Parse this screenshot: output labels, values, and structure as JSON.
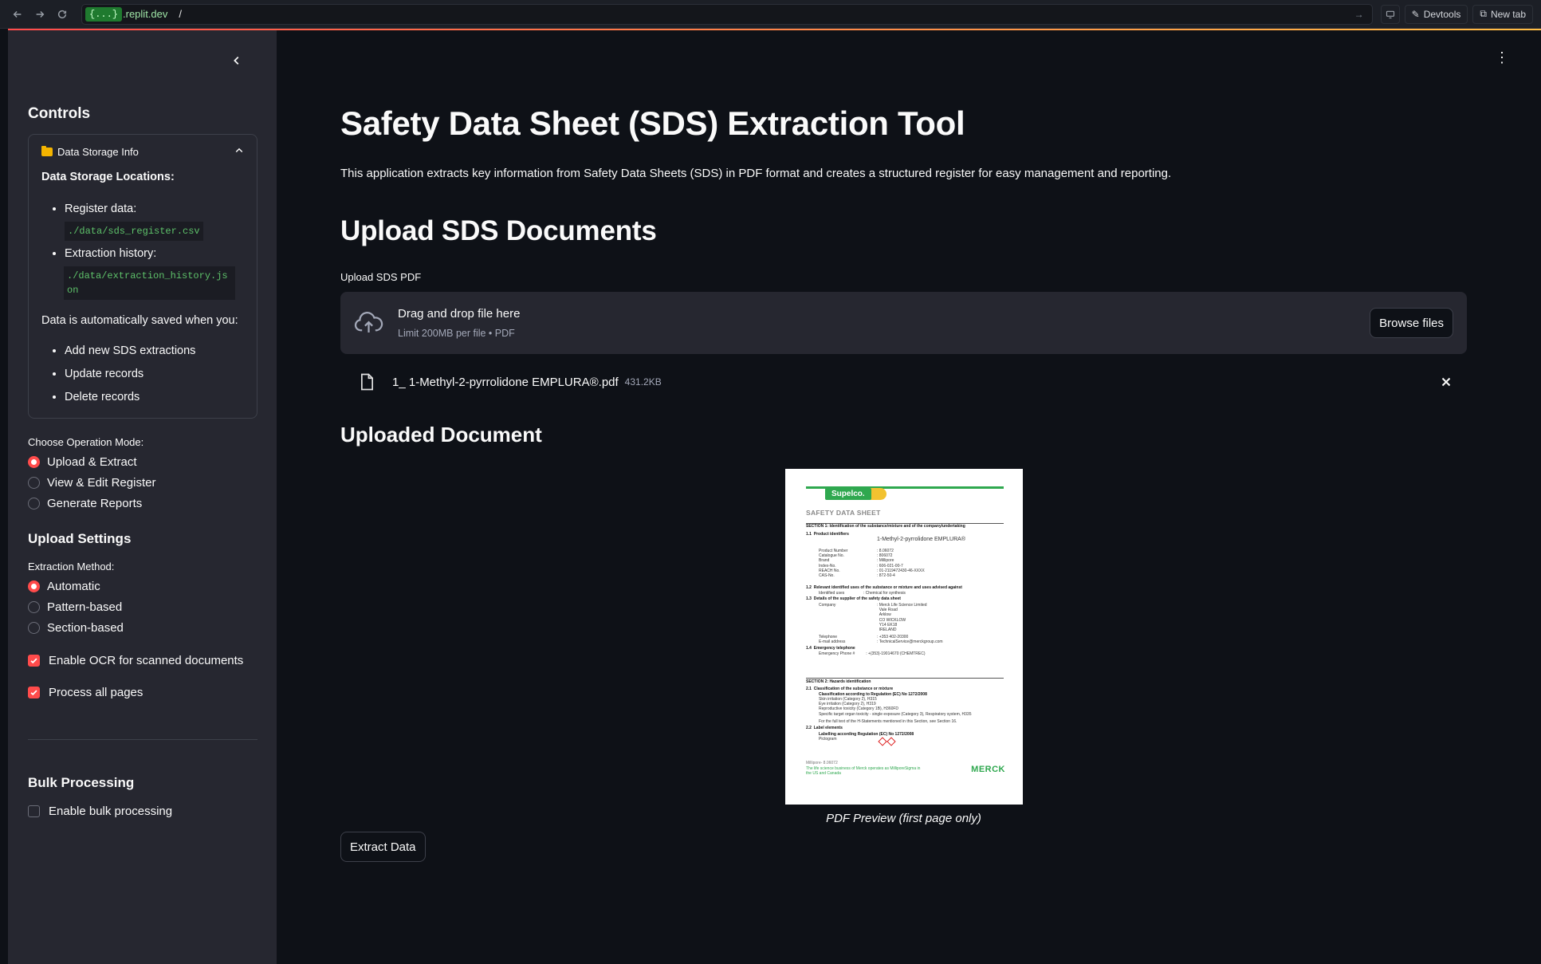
{
  "browser": {
    "url_badge": "{...}",
    "url_host": ".replit.dev",
    "url_path": "/",
    "devtools_label": "Devtools",
    "newtab_label": "New tab"
  },
  "sidebar": {
    "controls_title": "Controls",
    "expander": {
      "title": "Data Storage Info",
      "locations_heading": "Data Storage Locations:",
      "register_label": "Register data:",
      "register_path": "./data/sds_register.csv",
      "history_label": "Extraction history:",
      "history_path": "./data/extraction_history.json",
      "autosave_text": "Data is automatically saved when you:",
      "autosave_items": [
        "Add new SDS extractions",
        "Update records",
        "Delete records"
      ]
    },
    "mode": {
      "label": "Choose Operation Mode:",
      "options": [
        "Upload & Extract",
        "View & Edit Register",
        "Generate Reports"
      ],
      "selected": "Upload & Extract"
    },
    "upload_settings": {
      "title": "Upload Settings",
      "method_label": "Extraction Method:",
      "options": [
        "Automatic",
        "Pattern-based",
        "Section-based"
      ],
      "selected": "Automatic",
      "ocr_label": "Enable OCR for scanned documents",
      "ocr_checked": true,
      "all_pages_label": "Process all pages",
      "all_pages_checked": true
    },
    "bulk": {
      "title": "Bulk Processing",
      "enable_label": "Enable bulk processing",
      "enable_checked": false
    }
  },
  "main": {
    "title": "Safety Data Sheet (SDS) Extraction Tool",
    "intro": "This application extracts key information from Safety Data Sheets (SDS) in PDF format and creates a structured register for easy management and reporting.",
    "upload_heading": "Upload SDS Documents",
    "upload_label": "Upload SDS PDF",
    "dropzone_title": "Drag and drop file here",
    "dropzone_limit": "Limit 200MB per file • PDF",
    "browse_label": "Browse files",
    "file_name": "1_ 1-Methyl-2-pyrrolidone EMPLURA®.pdf",
    "file_size": "431.2KB",
    "uploaded_heading": "Uploaded Document",
    "preview_caption": "PDF Preview (first page only)",
    "extract_label": "Extract Data"
  },
  "pdf_preview": {
    "brand": "Supelco.",
    "sds_title": "SAFETY DATA SHEET",
    "section1": "SECTION 1: Identification of the substance/mixture and of the company/undertaking",
    "product_name": "1-Methyl-2-pyrrolidone EMPLURA®",
    "section2": "SECTION 2: Hazards identification",
    "footer_logo": "MERCK"
  },
  "colors": {
    "accent": "#ff4b4b",
    "background": "#0e1117",
    "sidebar": "#262730",
    "code_text": "#5ec26a"
  }
}
